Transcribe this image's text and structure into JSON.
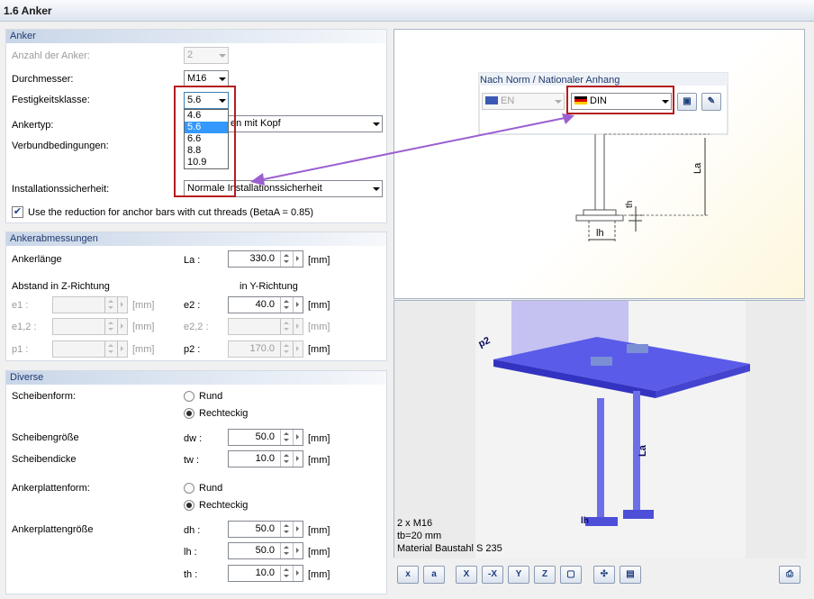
{
  "window": {
    "title": "1.6 Anker"
  },
  "anker": {
    "header": "Anker",
    "anzahl_label": "Anzahl der Anker:",
    "anzahl_value": "2",
    "durchmesser_label": "Durchmesser:",
    "durchmesser_value": "M16",
    "festigkeit_label": "Festigkeitsklasse:",
    "festigkeit_value": "5.6",
    "festigkeit_options": [
      "4.6",
      "5.6",
      "6.6",
      "8.8",
      "10.9"
    ],
    "ankertyp_label": "Ankertyp:",
    "ankertyp_value": "en mit Kopf",
    "verbund_label": "Verbundbedingungen:",
    "install_label": "Installationssicherheit:",
    "install_value": "Normale Installationssicherheit",
    "reduction_label": "Use the reduction for anchor bars with cut threads (BetaA = 0.85)",
    "reduction_checked": true
  },
  "abmessungen": {
    "header": "Ankerabmessungen",
    "laenge_label": "Ankerlänge",
    "la_symbol": "La :",
    "la_value": "330.0",
    "unit": "[mm]",
    "z_header": "Abstand in Z-Richtung",
    "y_header": "in Y-Richtung",
    "e1_label": "e1 :",
    "e12_label": "e1,2 :",
    "p1_label": "p1 :",
    "e2_label": "e2 :",
    "e2_value": "40.0",
    "e22_label": "e2,2 :",
    "p2_label": "p2 :",
    "p2_value": "170.0"
  },
  "diverse": {
    "header": "Diverse",
    "scheibenform_label": "Scheibenform:",
    "rund": "Rund",
    "rechteckig": "Rechteckig",
    "scheibengroesse_label": "Scheibengröße",
    "dw_label": "dw :",
    "dw_value": "50.0",
    "scheibendicke_label": "Scheibendicke",
    "tw_label": "tw :",
    "tw_value": "10.0",
    "ankerplattenform_label": "Ankerplattenform:",
    "ankerplattengroesse_label": "Ankerplattengröße",
    "dh_label": "dh :",
    "dh_value": "50.0",
    "lh_label": "lh :",
    "lh_value": "50.0",
    "th_label": "th :",
    "th_value": "10.0"
  },
  "norm": {
    "title": "Nach Norm / Nationaler Anhang",
    "en_value": "EN",
    "din_value": "DIN"
  },
  "drawing": {
    "la_label": "La",
    "th_label": "th",
    "lh_label": "lh"
  },
  "view3d": {
    "info_line1": "2 x M16",
    "info_line2": "tb=20 mm",
    "info_line3": "Material Baustahl S 235",
    "p2_label": "p2",
    "la_label": "La",
    "lh_label": "lh"
  },
  "colors": {
    "highlight": "#b51c1c",
    "arrow": "#9b5fcf",
    "accent": "#3399ff"
  }
}
